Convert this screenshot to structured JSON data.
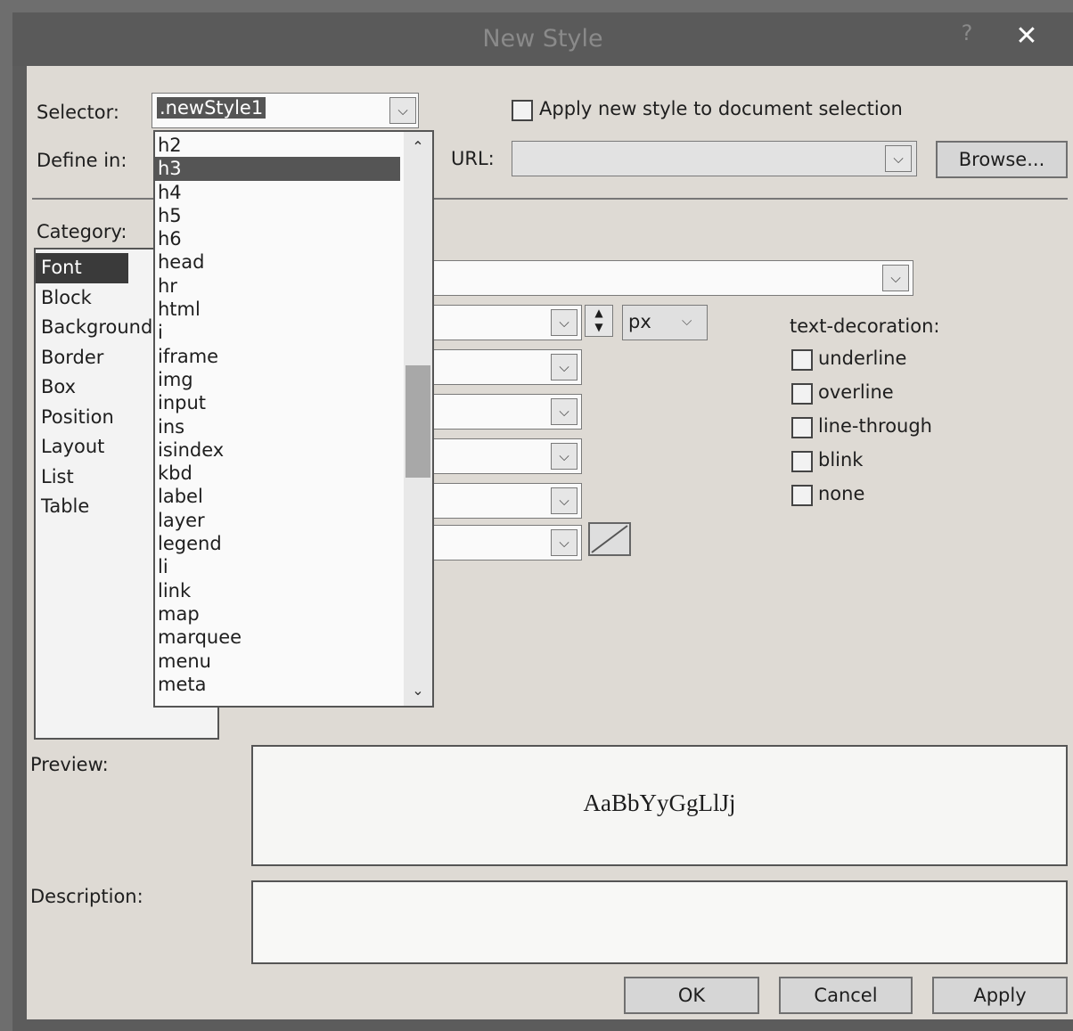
{
  "window": {
    "title": "New Style",
    "help_label": "?",
    "close_label": "✕"
  },
  "selector": {
    "label": "Selector:",
    "value": ".newStyle1"
  },
  "apply_new_style": {
    "label": "Apply new style to document selection",
    "checked": false
  },
  "define_in": {
    "label": "Define in:"
  },
  "url": {
    "label": "URL:",
    "value": ""
  },
  "browse_label": "Browse...",
  "category": {
    "label": "Category:",
    "items": [
      "Font",
      "Block",
      "Background",
      "Border",
      "Box",
      "Position",
      "Layout",
      "List",
      "Table"
    ],
    "selected": "Font"
  },
  "selector_dropdown": {
    "items": [
      "h2",
      "h3",
      "h4",
      "h5",
      "h6",
      "head",
      "hr",
      "html",
      "i",
      "iframe",
      "img",
      "input",
      "ins",
      "isindex",
      "kbd",
      "label",
      "layer",
      "legend",
      "li",
      "link",
      "map",
      "marquee",
      "menu",
      "meta"
    ],
    "selected": "h3"
  },
  "font_panel": {
    "size_unit": "px",
    "text_decoration": {
      "label": "text-decoration:",
      "options": [
        "underline",
        "overline",
        "line-through",
        "blink",
        "none"
      ]
    }
  },
  "preview": {
    "label": "Preview:",
    "sample": "AaBbYyGgLlJj"
  },
  "description": {
    "label": "Description:",
    "value": ""
  },
  "buttons": {
    "ok": "OK",
    "cancel": "Cancel",
    "apply": "Apply"
  },
  "icons": {
    "dropdown": "chevron-down-icon",
    "scroll_up": "chevron-up-icon",
    "close": "close-icon",
    "help": "help-icon",
    "color_picker": "color-swatch-icon"
  }
}
